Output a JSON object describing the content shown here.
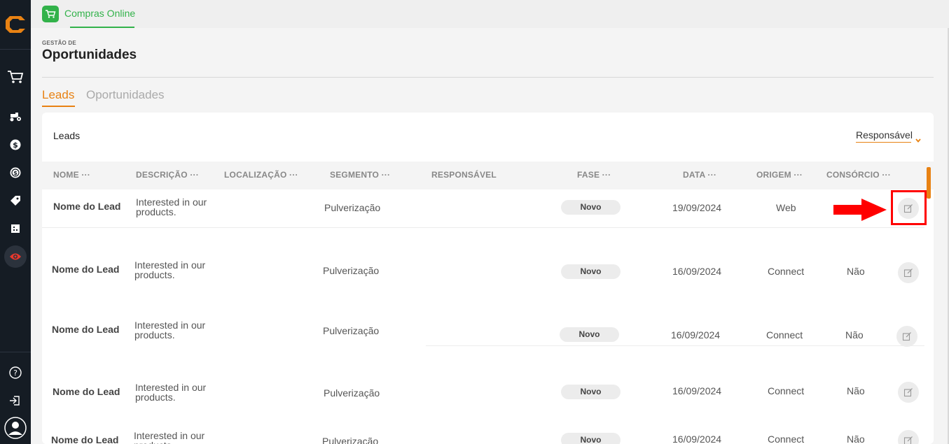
{
  "app": {
    "name": "Compras Online",
    "accent": "#32b24a",
    "brand": "#e88213"
  },
  "sidebar": {
    "top_icons": [
      "cart-icon"
    ],
    "items": [
      "tractor-icon",
      "dollar-circle-icon",
      "refresh-dollar-icon",
      "tag-icon",
      "grid-icon",
      "eye-icon"
    ],
    "bottom_icons": [
      "help-icon",
      "logout-icon",
      "user-avatar-icon"
    ],
    "active_item": "eye-icon"
  },
  "header": {
    "breadcrumb": "GESTÃO DE",
    "title": "Oportunidades"
  },
  "tabs": [
    {
      "label": "Leads",
      "active": true
    },
    {
      "label": "Oportunidades",
      "active": false
    }
  ],
  "card": {
    "title": "Leads",
    "filter_label": "Responsável"
  },
  "table": {
    "columns": {
      "nome": "NOME ···",
      "descricao": "DESCRIÇÃO ···",
      "localizacao": "LOCALIZAÇÃO ···",
      "segmento": "SEGMENTO ···",
      "responsavel": "RESPONSÁVEL",
      "fase": "FASE ···",
      "data": "DATA ···",
      "origem": "ORIGEM ···",
      "consorcio": "CONSÓRCIO ···"
    },
    "rows": [
      {
        "nome": "Nome do Lead",
        "descricao": "Interested in our products.",
        "segmento": "Pulverização",
        "fase": "Novo",
        "data": "19/09/2024",
        "origem": "Web",
        "consorcio": ""
      },
      {
        "nome": "Nome do Lead",
        "descricao": "Interested in our products.",
        "segmento": "Pulverização",
        "fase": "Novo",
        "data": "16/09/2024",
        "origem": "Connect",
        "consorcio": "Não"
      },
      {
        "nome": "Nome do Lead",
        "descricao": "Interested in our products.",
        "segmento": "Pulverização",
        "fase": "Novo",
        "data": "16/09/2024",
        "origem": "Connect",
        "consorcio": "Não"
      },
      {
        "nome": "Nome do Lead",
        "descricao": "Interested in our products.",
        "segmento": "Pulverização",
        "fase": "Novo",
        "data": "16/09/2024",
        "origem": "Connect",
        "consorcio": "Não"
      },
      {
        "nome": "Nome do Lead",
        "descricao": "Interested in our products.",
        "segmento": "Pulverização",
        "fase": "Novo",
        "data": "16/09/2024",
        "origem": "Connect",
        "consorcio": "Não"
      }
    ]
  }
}
